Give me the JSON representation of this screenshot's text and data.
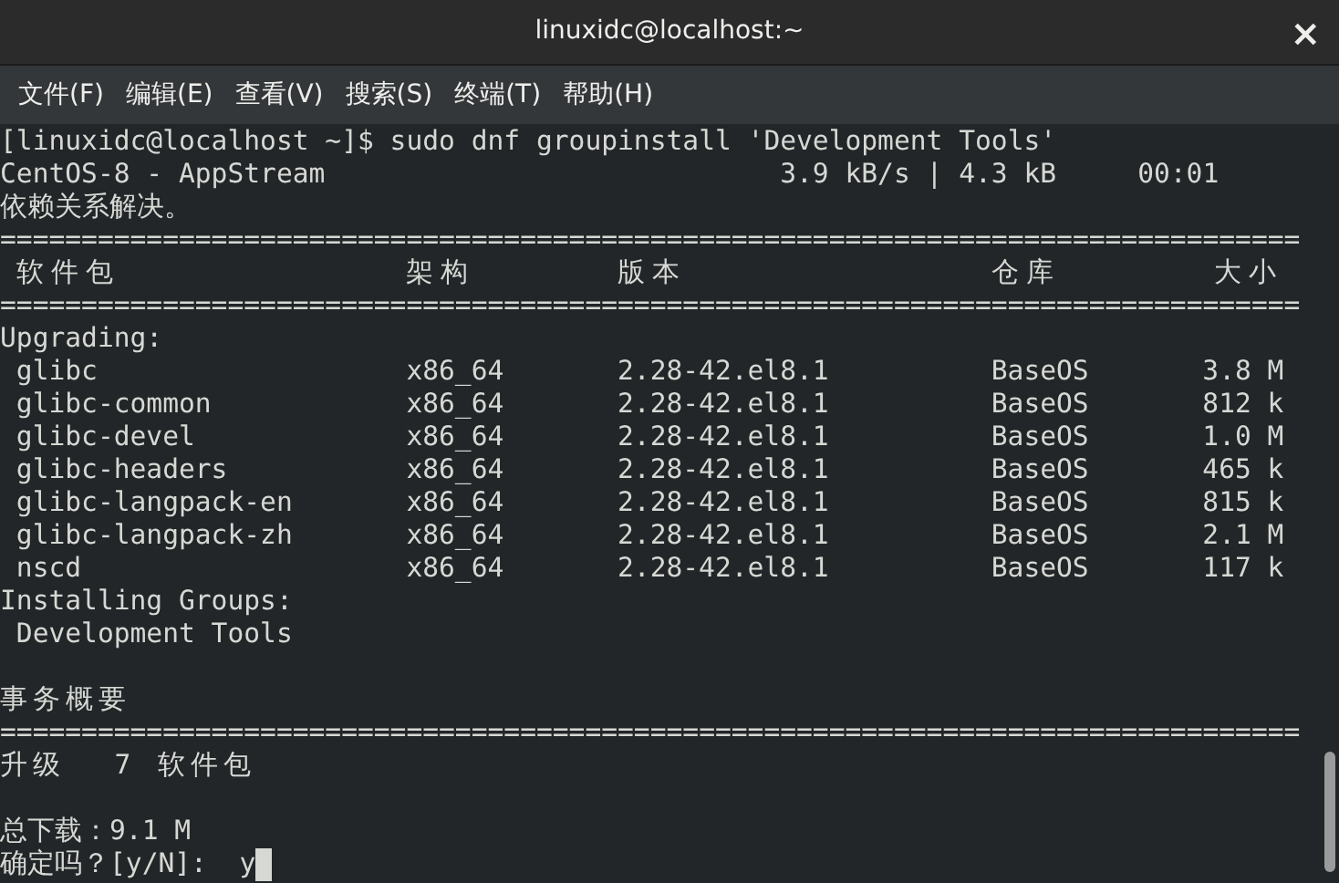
{
  "window": {
    "title": "linuxidc@localhost:~",
    "close": "×"
  },
  "menu": [
    "文件(F)",
    "编辑(E)",
    "查看(V)",
    "搜索(S)",
    "终端(T)",
    "帮助(H)"
  ],
  "terminal": {
    "prompt": "[linuxidc@localhost ~]$ sudo dnf groupinstall 'Development Tools'",
    "repo": {
      "name": "CentOS-8 - AppStream",
      "stats": "3.9 kB/s | 4.3 kB     00:01"
    },
    "resolved": "依赖关系解决。",
    "separator_top": "================================================================================",
    "columns": [
      "软件包",
      "架构",
      "版本",
      "仓库",
      "大小"
    ],
    "separator_mid": "================================================================================",
    "sections": [
      {
        "heading": "Upgrading:",
        "rows": [
          {
            "name": "glibc",
            "arch": "x86_64",
            "version": "2.28-42.el8.1",
            "repo": "BaseOS",
            "size": "3.8 M"
          },
          {
            "name": "glibc-common",
            "arch": "x86_64",
            "version": "2.28-42.el8.1",
            "repo": "BaseOS",
            "size": "812 k"
          },
          {
            "name": "glibc-devel",
            "arch": "x86_64",
            "version": "2.28-42.el8.1",
            "repo": "BaseOS",
            "size": "1.0 M"
          },
          {
            "name": "glibc-headers",
            "arch": "x86_64",
            "version": "2.28-42.el8.1",
            "repo": "BaseOS",
            "size": "465 k"
          },
          {
            "name": "glibc-langpack-en",
            "arch": "x86_64",
            "version": "2.28-42.el8.1",
            "repo": "BaseOS",
            "size": "815 k"
          },
          {
            "name": "glibc-langpack-zh",
            "arch": "x86_64",
            "version": "2.28-42.el8.1",
            "repo": "BaseOS",
            "size": "2.1 M"
          },
          {
            "name": "nscd",
            "arch": "x86_64",
            "version": "2.28-42.el8.1",
            "repo": "BaseOS",
            "size": "117 k"
          }
        ]
      },
      {
        "heading": "Installing Groups:",
        "groups": [
          "Development Tools"
        ]
      }
    ],
    "summary_title": "事务概要",
    "separator_bottom": "================================================================================",
    "upgrade_label": "升级",
    "upgrade_count": "7 软件包",
    "total": "总下载：9.1 M",
    "question": "确定吗？[y/N]:",
    "answer": "y"
  }
}
